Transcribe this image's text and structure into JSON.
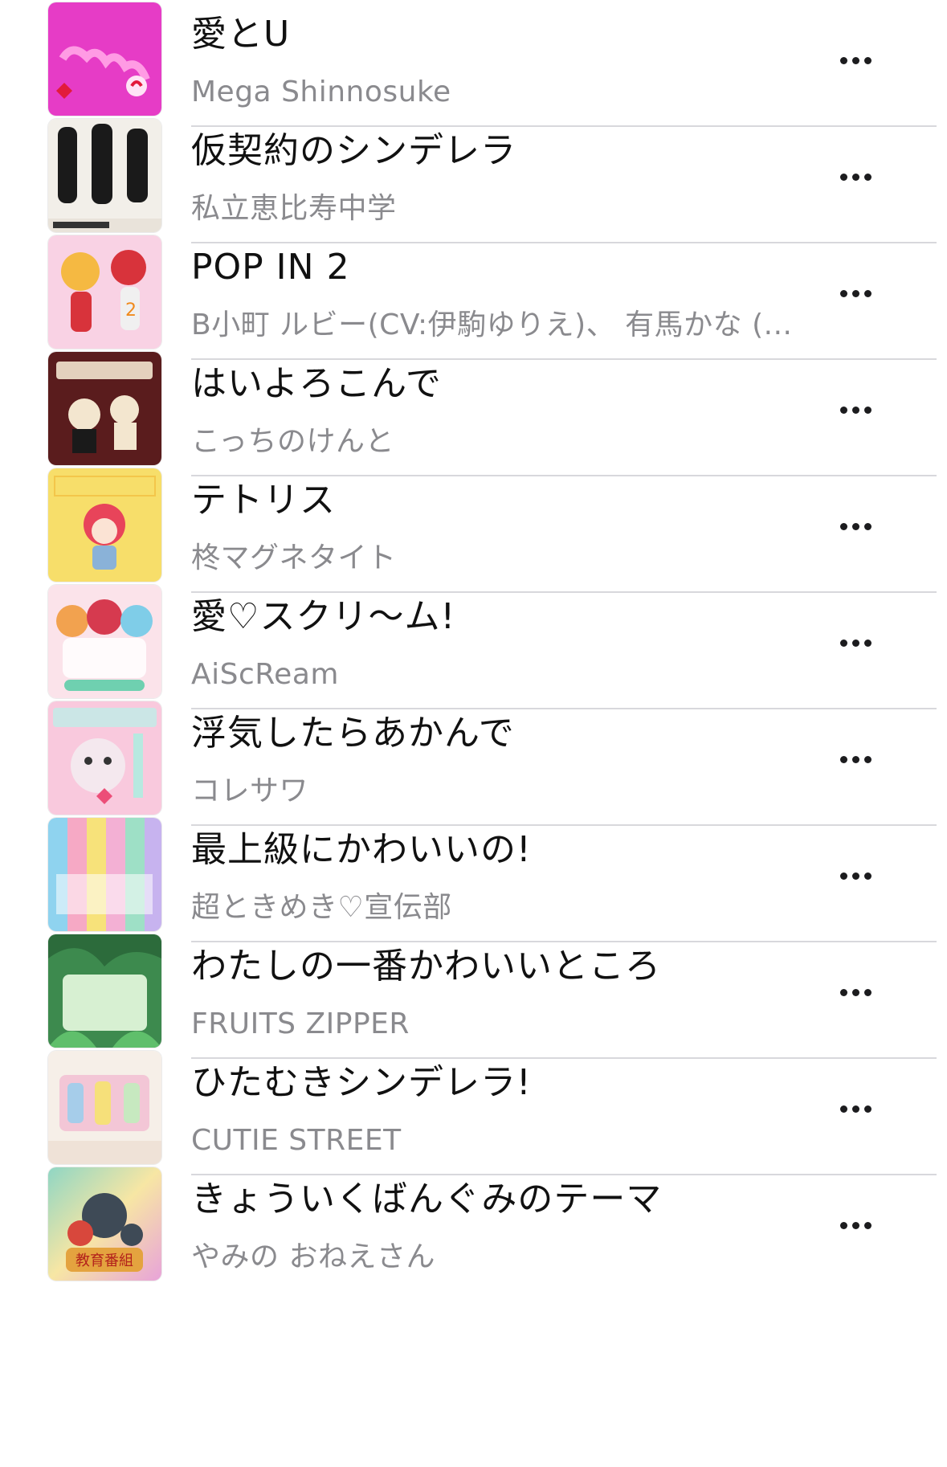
{
  "songs": [
    {
      "title": "愛とU",
      "artist": "Mega Shinnosuke",
      "artwork": "ai-to-u-artwork",
      "colors": [
        "#e63cc6",
        "#ff7bd9"
      ]
    },
    {
      "title": "仮契約のシンデレラ",
      "artist": "私立恵比寿中学",
      "artwork": "karikeiyaku-artwork",
      "colors": [
        "#f2efe9",
        "#1a1a1a"
      ]
    },
    {
      "title": "POP IN 2",
      "artist": "B小町 ルビー(CV:伊駒ゆりえ)、 有馬かな (...",
      "artwork": "pop-in-2-artwork",
      "colors": [
        "#f9d2e4",
        "#d8333b"
      ]
    },
    {
      "title": "はいよろこんで",
      "artist": "こっちのけんと",
      "artwork": "haiyorokonde-artwork",
      "colors": [
        "#5a1c1d",
        "#f3e6cf"
      ]
    },
    {
      "title": "テトリス",
      "artist": "柊マグネタイト",
      "artwork": "tetoris-artwork",
      "colors": [
        "#f7de6a",
        "#e8445a"
      ]
    },
    {
      "title": "愛♡スクリ～ム!",
      "artist": "AiScReam",
      "artwork": "ai-scream-artwork",
      "colors": [
        "#fbe3ea",
        "#e3576f"
      ]
    },
    {
      "title": "浮気したらあかんで",
      "artist": "コレサワ",
      "artwork": "uwaki-artwork",
      "colors": [
        "#f9c9dd",
        "#f4e8ee"
      ]
    },
    {
      "title": "最上級にかわいいの!",
      "artist": "超ときめき♡宣伝部",
      "artwork": "saijoukyuu-artwork",
      "colors": [
        "#8fd3ef",
        "#f6a9c5"
      ]
    },
    {
      "title": "わたしの一番かわいいところ",
      "artist": "FRUITS ZIPPER",
      "artwork": "watashi-no-ichiban-artwork",
      "colors": [
        "#3d8a4e",
        "#d7f0d2"
      ]
    },
    {
      "title": "ひたむきシンデレラ!",
      "artist": "CUTIE STREET",
      "artwork": "hitamuki-artwork",
      "colors": [
        "#f6efe8",
        "#f3c6d6"
      ]
    },
    {
      "title": "きょういくばんぐみのテーマ",
      "artist": "やみの おねえさん",
      "artwork": "kyouiku-artwork",
      "colors": [
        "#8fd6c4",
        "#e8a3d9"
      ]
    }
  ],
  "artwork_text": {
    "kyouiku": "教育番組"
  }
}
